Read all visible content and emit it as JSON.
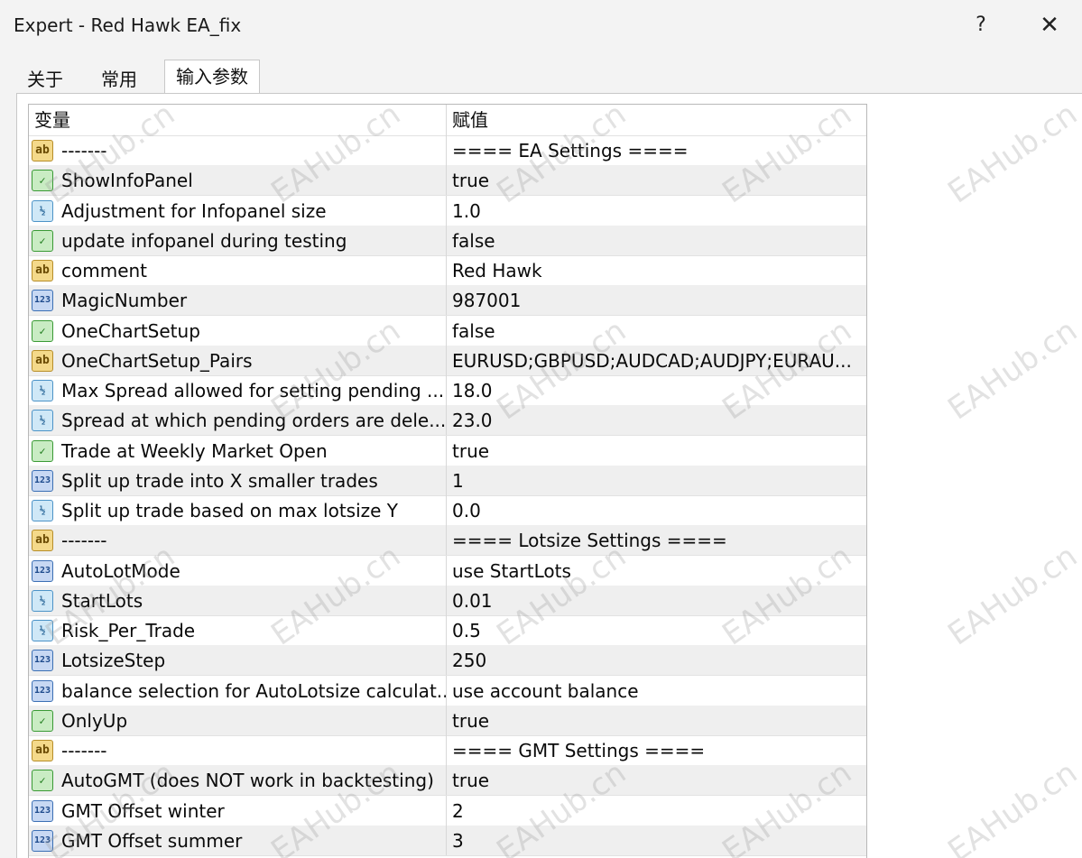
{
  "window": {
    "title": "Expert - Red Hawk EA_fix",
    "help_label": "?",
    "close_label": "✕"
  },
  "tabs": [
    {
      "label": "关于"
    },
    {
      "label": "常用"
    },
    {
      "label": "输入参数"
    }
  ],
  "grid": {
    "headers": {
      "name": "变量",
      "value": "赋值"
    },
    "rows": [
      {
        "icon": "ab",
        "name": "-------",
        "value": "==== EA Settings ===="
      },
      {
        "icon": "bool",
        "name": "ShowInfoPanel",
        "value": "true"
      },
      {
        "icon": "double",
        "name": "Adjustment for Infopanel size",
        "value": "1.0"
      },
      {
        "icon": "bool",
        "name": "update infopanel during testing",
        "value": "false"
      },
      {
        "icon": "ab",
        "name": "comment",
        "value": "Red Hawk"
      },
      {
        "icon": "int",
        "name": "MagicNumber",
        "value": "987001"
      },
      {
        "icon": "bool",
        "name": "OneChartSetup",
        "value": "false"
      },
      {
        "icon": "ab",
        "name": "OneChartSetup_Pairs",
        "value": "EURUSD;GBPUSD;AUDCAD;AUDJPY;EURAU..."
      },
      {
        "icon": "double",
        "name": "Max Spread allowed for setting pending ...",
        "value": "18.0"
      },
      {
        "icon": "double",
        "name": "Spread at which pending orders are dele...",
        "value": "23.0"
      },
      {
        "icon": "bool",
        "name": "Trade at Weekly Market Open",
        "value": "true"
      },
      {
        "icon": "int",
        "name": "Split up trade into X smaller trades",
        "value": "1"
      },
      {
        "icon": "double",
        "name": "Split up trade based on max lotsize Y",
        "value": "0.0"
      },
      {
        "icon": "ab",
        "name": "-------",
        "value": "==== Lotsize Settings ===="
      },
      {
        "icon": "int",
        "name": "AutoLotMode",
        "value": "use StartLots"
      },
      {
        "icon": "double",
        "name": "StartLots",
        "value": "0.01"
      },
      {
        "icon": "double",
        "name": "Risk_Per_Trade",
        "value": "0.5"
      },
      {
        "icon": "int",
        "name": "LotsizeStep",
        "value": "250"
      },
      {
        "icon": "int",
        "name": "balance selection for AutoLotsize calculat...",
        "value": "use account balance"
      },
      {
        "icon": "bool",
        "name": "OnlyUp",
        "value": "true"
      },
      {
        "icon": "ab",
        "name": "-------",
        "value": "==== GMT Settings ===="
      },
      {
        "icon": "bool",
        "name": "AutoGMT (does NOT work in backtesting)",
        "value": "true"
      },
      {
        "icon": "int",
        "name": "GMT Offset winter",
        "value": "2"
      },
      {
        "icon": "int",
        "name": "GMT Offset summer",
        "value": "3"
      }
    ]
  },
  "icons": {
    "ab": {
      "glyph": "ab",
      "name": "string-type-icon"
    },
    "bool": {
      "glyph": "✓",
      "name": "bool-type-icon"
    },
    "double": {
      "glyph": "½",
      "name": "double-type-icon"
    },
    "int": {
      "glyph": "123",
      "name": "integer-type-icon"
    }
  },
  "watermark": "EAHub.cn"
}
